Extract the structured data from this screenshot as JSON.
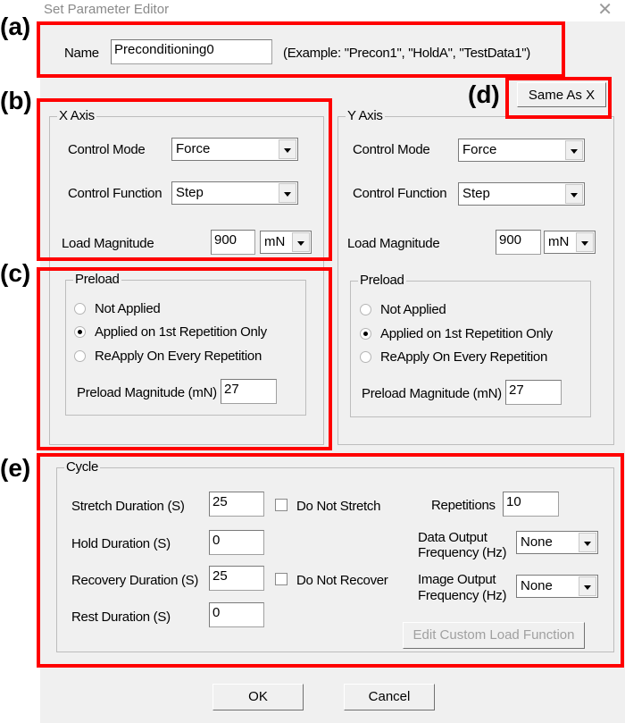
{
  "window": {
    "title": "Set Parameter Editor",
    "close_icon": "close-icon"
  },
  "name_section": {
    "label": "Name",
    "value": "Preconditioning0",
    "example": "(Example: \"Precon1\", \"HoldA\", \"TestData1\")"
  },
  "same_as_x_button": "Same As X",
  "x_axis": {
    "title": "X Axis",
    "control_mode_label": "Control Mode",
    "control_mode_value": "Force",
    "control_function_label": "Control Function",
    "control_function_value": "Step",
    "load_magnitude_label": "Load Magnitude",
    "load_magnitude_value": "900",
    "load_unit": "mN",
    "preload": {
      "title": "Preload",
      "options": [
        "Not Applied",
        "Applied on 1st Repetition Only",
        "ReApply On Every Repetition"
      ],
      "selected": 1,
      "magnitude_label": "Preload Magnitude (mN)",
      "magnitude_value": "27"
    }
  },
  "y_axis": {
    "title": "Y Axis",
    "control_mode_label": "Control Mode",
    "control_mode_value": "Force",
    "control_function_label": "Control Function",
    "control_function_value": "Step",
    "load_magnitude_label": "Load Magnitude",
    "load_magnitude_value": "900",
    "load_unit": "mN",
    "preload": {
      "title": "Preload",
      "options": [
        "Not Applied",
        "Applied on 1st Repetition Only",
        "ReApply On Every Repetition"
      ],
      "selected": 1,
      "magnitude_label": "Preload Magnitude (mN)",
      "magnitude_value": "27"
    }
  },
  "cycle": {
    "title": "Cycle",
    "stretch_label": "Stretch Duration (S)",
    "stretch_value": "25",
    "hold_label": "Hold Duration (S)",
    "hold_value": "0",
    "recovery_label": "Recovery Duration (S)",
    "recovery_value": "25",
    "rest_label": "Rest Duration (S)",
    "rest_value": "0",
    "do_not_stretch_label": "Do Not Stretch",
    "do_not_stretch_checked": false,
    "do_not_recover_label": "Do Not Recover",
    "do_not_recover_checked": false,
    "repetitions_label": "Repetitions",
    "repetitions_value": "10",
    "data_output_label_1": "Data Output",
    "data_output_label_2": "Frequency (Hz)",
    "data_output_value": "None",
    "image_output_label_1": "Image Output",
    "image_output_label_2": "Frequency (Hz)",
    "image_output_value": "None",
    "edit_custom_button": "Edit Custom Load Function"
  },
  "footer": {
    "ok": "OK",
    "cancel": "Cancel"
  },
  "annotations": {
    "a": "(a)",
    "b": "(b)",
    "c": "(c)",
    "d": "(d)",
    "e": "(e)",
    "color": "#ff0000"
  }
}
